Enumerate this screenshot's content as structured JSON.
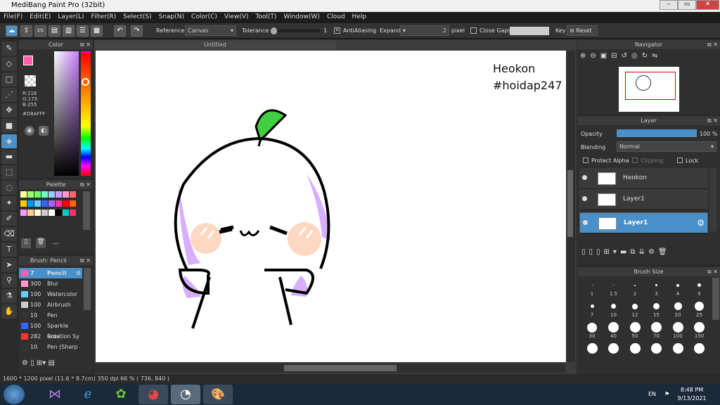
{
  "window": {
    "title": "MediBang Paint Pro (32bit)"
  },
  "menu": [
    "File(F)",
    "Edit(E)",
    "Layer(L)",
    "Filter(R)",
    "Select(S)",
    "Snap(N)",
    "Color(C)",
    "View(V)",
    "Tool(T)",
    "Window(W)",
    "Cloud",
    "Help"
  ],
  "toolbar": {
    "reference_label": "Reference",
    "reference_value": "Canvas",
    "tolerance_label": "Tolerance",
    "tolerance_value": "1",
    "antialiasing_label": "AntiAliasing",
    "expand_label": "Expand",
    "expand_value": "2",
    "expand_unit": "pixel",
    "close_gaps_label": "Close Gaps",
    "key_label": "Key",
    "reset_label": "Reset"
  },
  "color_panel": {
    "title": "Color",
    "r": "R:216",
    "g": "G:175",
    "b": "B:255",
    "hex": "#D8AFFF",
    "fg": "#ff5fa8",
    "bg": "#000000"
  },
  "palette_panel": {
    "title": "Palette",
    "colors": [
      "#ffff99",
      "#99ff66",
      "#66ff66",
      "#66ffcc",
      "#99ccff",
      "#cc99ff",
      "#ff99cc",
      "#ff6666",
      "#ffcc00",
      "#0099ff",
      "#66ccff",
      "#3366ff",
      "#9966ff",
      "#ff3399",
      "#ff0000",
      "#ff6600",
      "#ff99ff",
      "#ffcc99",
      "#ffffcc",
      "#cccccc",
      "#ffffff",
      "#000000",
      "#00cccc",
      "#ff3366"
    ],
    "extra": "---"
  },
  "brush_panel": {
    "title": "Brush: Pencil",
    "items": [
      {
        "size": "7",
        "name": "Pencil",
        "color": "#ff5fa8"
      },
      {
        "size": "300",
        "name": "Blur",
        "color": "#ff99cc"
      },
      {
        "size": "100",
        "name": "Watercolor",
        "color": "#66ccff"
      },
      {
        "size": "100",
        "name": "Airbrush",
        "color": "#cccccc"
      },
      {
        "size": "10",
        "name": "Pen",
        "color": "#333333"
      },
      {
        "size": "100",
        "name": "Sparkle Brus",
        "color": "#3366ff"
      },
      {
        "size": "282",
        "name": "Rotation Sy",
        "color": "#ff3333"
      },
      {
        "size": "10",
        "name": "Pen (Sharp",
        "color": "#333333"
      }
    ]
  },
  "canvas": {
    "title": "Untitled",
    "text_line1": "Heokon",
    "text_line2": "#hoidap247"
  },
  "navigator": {
    "title": "Navigator"
  },
  "layer_panel": {
    "title": "Layer",
    "opacity_label": "Opacity",
    "opacity_value": "100 %",
    "opacity_fraction": 1.0,
    "blending_label": "Blending",
    "blending_value": "Normal",
    "protect_alpha": "Protect Alpha",
    "clipping": "Clipping",
    "lock": "Lock",
    "layers": [
      {
        "name": "Heokon",
        "selected": false
      },
      {
        "name": "Layer1",
        "selected": false
      },
      {
        "name": "Layer1",
        "selected": true
      }
    ]
  },
  "brush_size_panel": {
    "title": "Brush Size",
    "sizes": [
      "1",
      "1.5",
      "2",
      "3",
      "4",
      "5",
      "7",
      "10",
      "12",
      "15",
      "20",
      "25",
      "30",
      "40",
      "50",
      "70",
      "100",
      "150",
      "",
      "",
      "",
      "",
      "",
      ""
    ]
  },
  "status": {
    "text": "1600 * 1200 pixel   (11.6 * 8.7cm)   350 dpi   66 %   ( 736, 840 )"
  },
  "taskbar": {
    "lang": "EN",
    "time": "8:48 PM",
    "date": "9/13/2021"
  }
}
